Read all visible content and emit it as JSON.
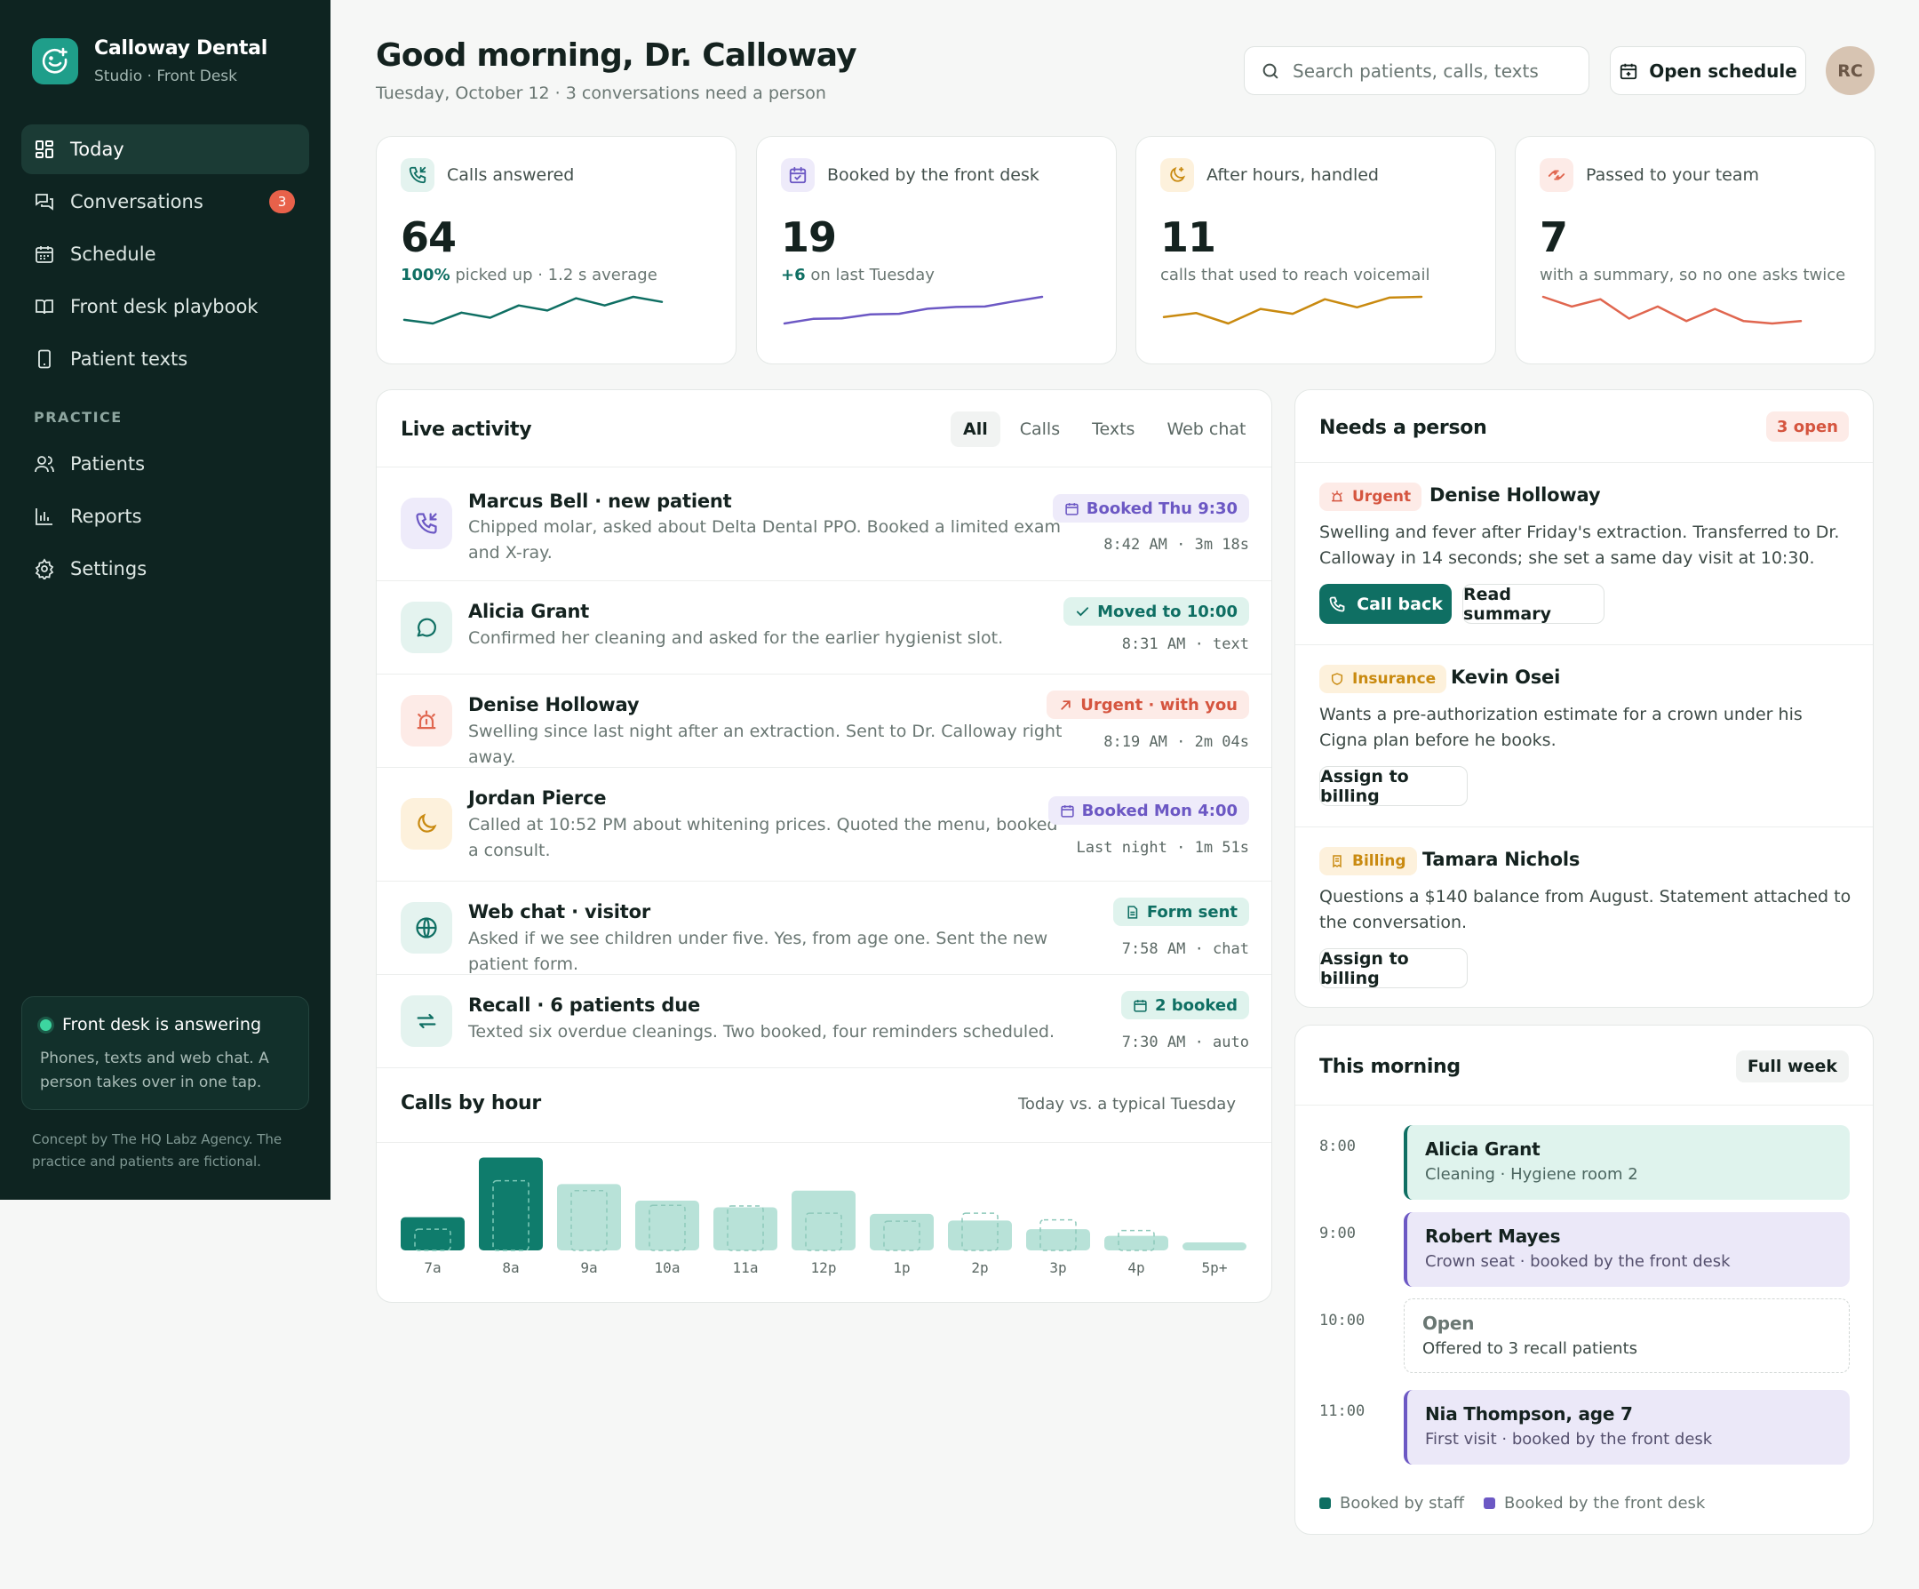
{
  "brand": {
    "name": "Calloway Dental",
    "subtitle": "Studio · Front Desk"
  },
  "nav": {
    "items": [
      {
        "label": "Today",
        "icon": "grid-icon",
        "active": true
      },
      {
        "label": "Conversations",
        "icon": "chat-icon",
        "badge": "3"
      },
      {
        "label": "Schedule",
        "icon": "calendar-icon"
      },
      {
        "label": "Front desk playbook",
        "icon": "book-icon"
      },
      {
        "label": "Patient texts",
        "icon": "phone-icon"
      }
    ],
    "section_label": "PRACTICE",
    "practice_items": [
      {
        "label": "Patients",
        "icon": "users-icon"
      },
      {
        "label": "Reports",
        "icon": "bar-chart-icon"
      },
      {
        "label": "Settings",
        "icon": "gear-icon"
      }
    ]
  },
  "status": {
    "title": "Front desk is answering",
    "description": "Phones, texts and web chat. A person takes over in one tap."
  },
  "credit": "Concept by The HQ Labz Agency. The practice and patients are fictional.",
  "header": {
    "title": "Good morning, Dr. Calloway",
    "subtitle": "Tuesday, October 12 · 3 conversations need a person",
    "search_placeholder": "Search patients, calls, texts",
    "open_schedule": "Open schedule",
    "avatar_initials": "RC"
  },
  "colors": {
    "teal": "#0f6f63",
    "purple": "#6c58c4",
    "amber": "#c98a10",
    "coral": "#e0664f",
    "sidebar": "#0e2421"
  },
  "stats": [
    {
      "label": "Calls answered",
      "value": "64",
      "highlight": "100%",
      "sub": " picked up · 1.2 s average",
      "icon": "phone-incoming-icon",
      "trend": [
        3,
        2.5,
        4,
        3.3,
        5,
        4.3,
        6,
        5,
        6.2,
        5.5
      ]
    },
    {
      "label": "Booked by the front desk",
      "value": "19",
      "highlight": "+6",
      "sub": " on last Tuesday",
      "icon": "calendar-check-icon",
      "trend": [
        2,
        3,
        3.1,
        4,
        4.1,
        5.2,
        5.6,
        5.7,
        6.8,
        7.8
      ]
    },
    {
      "label": "After hours, handled",
      "value": "11",
      "sub": "calls that used to reach voicemail",
      "icon": "moon-icon",
      "trend": [
        4,
        4.5,
        3.2,
        5,
        4.4,
        6.2,
        5.2,
        6.4,
        6.5
      ]
    },
    {
      "label": "Passed to your team",
      "value": "7",
      "sub": "with a summary, so no one asks twice",
      "icon": "handoff-icon",
      "trend": [
        6,
        5.6,
        5.9,
        5.1,
        5.6,
        5,
        5.5,
        5,
        4.9,
        5
      ]
    }
  ],
  "activity": {
    "title": "Live activity",
    "filters": [
      "All",
      "Calls",
      "Texts",
      "Web chat"
    ],
    "items": [
      {
        "name": "Marcus Bell · new patient",
        "desc": "Chipped molar, asked about Delta Dental PPO. Booked a limited exam and X-ray.",
        "tag": "Booked Thu 9:30",
        "meta": "8:42 AM · 3m 18s",
        "icon": "phone-call-icon"
      },
      {
        "name": "Alicia Grant",
        "desc": "Confirmed her cleaning and asked for the earlier hygienist slot.",
        "tag": "Moved to 10:00",
        "meta": "8:31 AM · text",
        "icon": "message-icon"
      },
      {
        "name": "Denise Holloway",
        "desc": "Swelling since last night after an extraction. Sent to Dr. Calloway right away.",
        "tag": "Urgent · with you",
        "meta": "8:19 AM · 2m 04s",
        "icon": "alarm-icon"
      },
      {
        "name": "Jordan Pierce",
        "desc": "Called at 10:52 PM about whitening prices. Quoted the menu, booked a consult.",
        "tag": "Booked Mon 4:00",
        "meta": "Last night · 1m 51s",
        "icon": "moon-icon"
      },
      {
        "name": "Web chat · visitor",
        "desc": "Asked if we see children under five. Yes, from age one. Sent the new patient form.",
        "tag": "Form sent",
        "meta": "7:58 AM · chat",
        "icon": "globe-icon"
      },
      {
        "name": "Recall · 6 patients due",
        "desc": "Texted six overdue cleanings. Two booked, four reminders scheduled.",
        "tag": "2 booked",
        "meta": "7:30 AM · auto",
        "icon": "repeat-icon"
      }
    ]
  },
  "chart_title": "Calls by hour",
  "chart_subtitle": "Today vs. a typical Tuesday",
  "chart_data": {
    "type": "bar",
    "categories": [
      "7a",
      "8a",
      "9a",
      "10a",
      "11a",
      "12p",
      "1p",
      "2p",
      "3p",
      "4p",
      "5p+"
    ],
    "series": [
      {
        "values": [
          5,
          14,
          10,
          7.5,
          6.5,
          9,
          5.5,
          4.5,
          3.2,
          2.2,
          1.2
        ]
      },
      {
        "values": [
          3.2,
          10.5,
          9,
          6.8,
          6.7,
          5.6,
          4.4,
          5.6,
          4.6,
          3,
          0
        ]
      }
    ],
    "ylim": [
      0,
      15
    ],
    "grid": false,
    "legend": "none"
  },
  "needs": {
    "title": "Needs a person",
    "open_count": "3 open",
    "items": [
      {
        "tag": "Urgent",
        "name": "Denise Holloway",
        "desc": "Swelling and fever after Friday's extraction. Transferred to Dr. Calloway in 14 seconds; she set a same day visit at 10:30.",
        "primary_action": "Call back",
        "secondary_action": "Read summary",
        "icon": "alarm-icon"
      },
      {
        "tag": "Insurance",
        "name": "Kevin Osei",
        "desc": "Wants a pre-authorization estimate for a crown under his Cigna plan before he books.",
        "secondary_action": "Assign to billing",
        "icon": "shield-icon"
      },
      {
        "tag": "Billing",
        "name": "Tamara Nichols",
        "desc": "Questions a $140 balance from August. Statement attached to the conversation.",
        "secondary_action": "Assign to billing",
        "icon": "receipt-icon"
      }
    ]
  },
  "morning": {
    "title": "This morning",
    "full_week": "Full week",
    "slots": [
      {
        "time": "8:00",
        "title": "Alicia Grant",
        "sub": "Cleaning · Hygiene room 2",
        "kind": "staff"
      },
      {
        "time": "9:00",
        "title": "Robert Mayes",
        "sub": "Crown seat · booked by the front desk",
        "kind": "front-desk"
      },
      {
        "time": "10:00",
        "title": "Open",
        "sub": "Offered to 3 recall patients",
        "kind": "open"
      },
      {
        "time": "11:00",
        "title": "Nia Thompson, age 7",
        "sub": "First visit · booked by the front desk",
        "kind": "front-desk"
      }
    ],
    "legend": [
      "Booked by staff",
      "Booked by the front desk"
    ]
  }
}
